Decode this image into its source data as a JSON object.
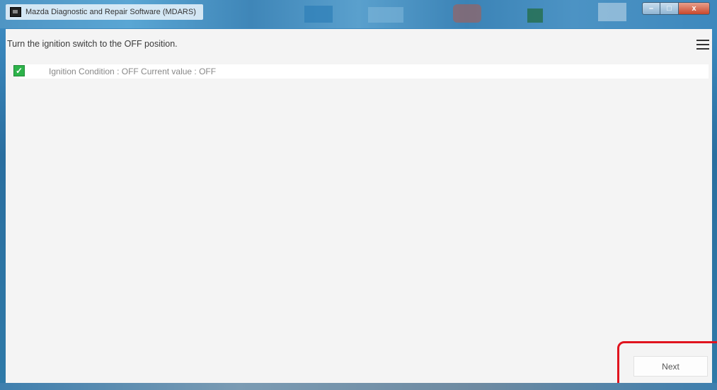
{
  "window": {
    "title": "Mazda Diagnostic and Repair Software (MDARS)",
    "controls": {
      "minimize": "–",
      "maximize": "□",
      "close": "x"
    }
  },
  "main": {
    "instruction": "Turn the ignition switch to the OFF position.",
    "condition": {
      "checked": true,
      "check_glyph": "✓",
      "text": "Ignition Condition : OFF Current value : OFF"
    },
    "next_label": "Next"
  },
  "colors": {
    "checkbox": "#2db34a",
    "highlight": "#e0141e",
    "client_background": "#f4f4f4"
  },
  "icons": {
    "menu": "hamburger-menu-icon",
    "app": "mdars-app-icon"
  }
}
